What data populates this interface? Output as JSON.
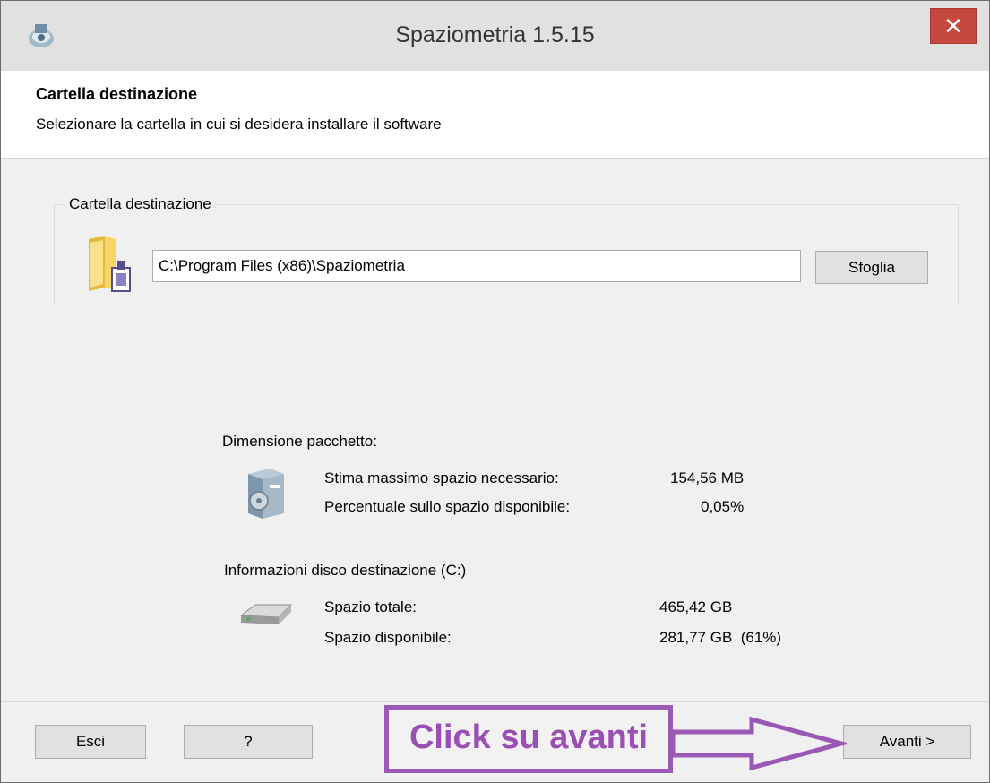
{
  "window": {
    "title": "Spaziometria 1.5.15",
    "close_glyph": "✕"
  },
  "header": {
    "title": "Cartella destinazione",
    "subtitle": "Selezionare la cartella in cui si desidera installare il software"
  },
  "destination": {
    "group_label": "Cartella destinazione",
    "path_value": "C:\\Program Files (x86)\\Spaziometria",
    "browse_label": "Sfoglia"
  },
  "package": {
    "section_label": "Dimensione pacchetto:",
    "rows": [
      {
        "label": "Stima massimo spazio necessario:",
        "value": "154,56 MB"
      },
      {
        "label": "Percentuale sullo spazio disponibile:",
        "value": "0,05%"
      }
    ]
  },
  "disk": {
    "section_label": "Informazioni disco destinazione (C:)",
    "rows": [
      {
        "label": "Spazio totale:",
        "value": "465,42 GB"
      },
      {
        "label": "Spazio disponibile:",
        "value": "281,77 GB  (61%)"
      }
    ]
  },
  "footer": {
    "exit_label": "Esci",
    "help_label": "?",
    "next_label": "Avanti >"
  },
  "annotation": {
    "text": "Click su avanti",
    "color": "#9b59b6"
  },
  "icons": {
    "app": "app-icon",
    "folder": "folder-install-icon",
    "package": "package-box-icon",
    "disk": "hard-disk-icon"
  }
}
